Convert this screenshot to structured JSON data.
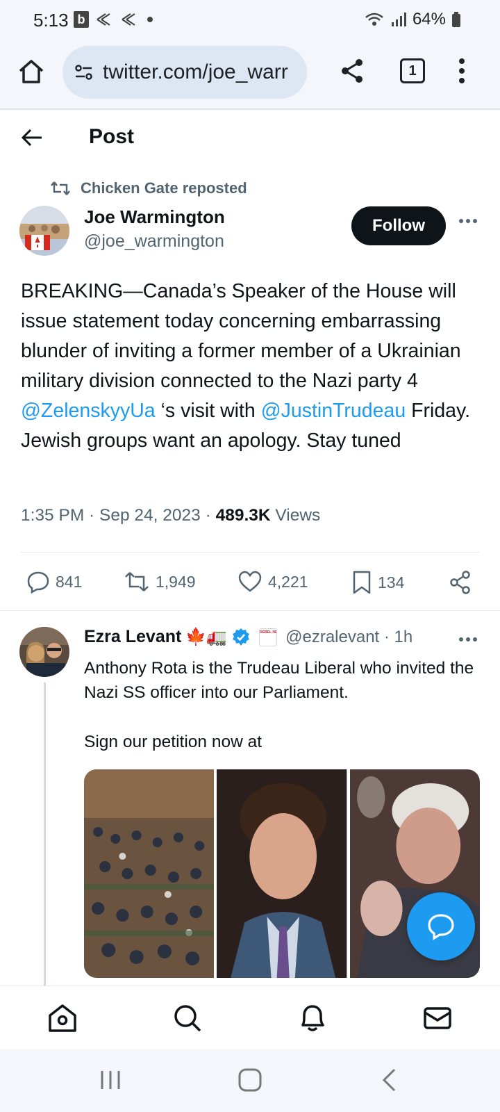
{
  "status_bar": {
    "time": "5:13",
    "b_icon": "b",
    "battery": "64%"
  },
  "browser": {
    "url": "twitter.com/joe_warr",
    "tab_count": "1"
  },
  "header": {
    "title": "Post"
  },
  "repost": {
    "text": "Chicken Gate reposted"
  },
  "tweet": {
    "author_name": "Joe Warmington",
    "author_handle": "@joe_warmington",
    "follow_label": "Follow",
    "text_parts": [
      "BREAKING—Canada’s Speaker of the House will issue statement today concerning embarrassing blunder of inviting a former member of a Ukrainian military division connected to the Nazi party 4 ",
      "@ZelenskyyUa",
      " ‘s visit with ",
      "@JustinTrudeau",
      " Friday. Jewish groups want an apology. Stay tuned"
    ],
    "time": "1:35 PM · Sep 24, 2023 · ",
    "views_count": "489.3K",
    "views_label": " Views",
    "replies": "841",
    "reposts": "1,949",
    "likes": "4,221",
    "bookmarks": "134"
  },
  "reply": {
    "author_name": "Ezra Levant",
    "emojis": "🍁🚛",
    "badge_text": "REBEL NEWS",
    "handle_time": "@ezralevant · 1h",
    "text_line1": "Anthony Rota is the Trudeau Liberal who invited the Nazi SS officer into our Parliament.",
    "text_line2": "Sign our petition now at"
  },
  "colors": {
    "accent": "#1d9bf0",
    "text": "#0f1419",
    "secondary": "#536471",
    "chrome": "#f4f6fb"
  },
  "icons": [
    "home-icon",
    "site-settings-icon",
    "share-icon",
    "tabs-icon",
    "menu-icon",
    "back-arrow-icon",
    "repost-icon",
    "more-icon",
    "reply-icon",
    "like-icon",
    "bookmark-icon",
    "verified-icon",
    "compose-icon",
    "search-icon",
    "notifications-icon",
    "messages-icon"
  ]
}
